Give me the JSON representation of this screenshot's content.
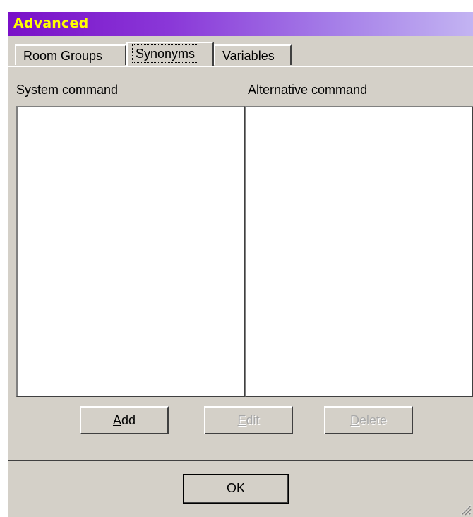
{
  "window": {
    "title": "Advanced"
  },
  "tabs": [
    {
      "label": "Room Groups",
      "active": false
    },
    {
      "label": "Synonyms",
      "active": true
    },
    {
      "label": "Variables",
      "active": false
    }
  ],
  "synonyms": {
    "system_command_label": "System command",
    "alternative_command_label": "Alternative command",
    "system_commands": [],
    "alternative_commands": []
  },
  "buttons": {
    "add": {
      "mnemonic": "A",
      "rest": "dd",
      "enabled": true
    },
    "edit": {
      "mnemonic": "E",
      "rest": "dit",
      "enabled": false
    },
    "delete": {
      "mnemonic": "D",
      "rest": "elete",
      "enabled": false
    },
    "ok": {
      "label": "OK"
    }
  },
  "colors": {
    "title_text": "#ffff00",
    "title_gradient_start": "#7a10c8",
    "title_gradient_end": "#c3b4f2",
    "face": "#d4d0c8"
  },
  "icons": {
    "resize_grip": "size-grip-icon"
  }
}
